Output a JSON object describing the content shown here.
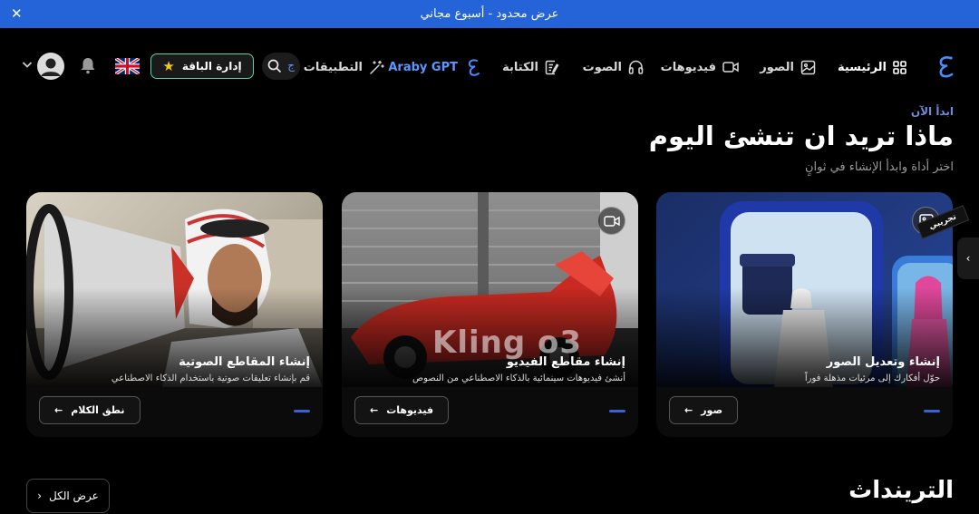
{
  "promo": {
    "text": "عرض محدود - أسبوع مجاني"
  },
  "nav": {
    "home": "الرئيسية",
    "images": "الصور",
    "videos": "فيديوهات",
    "audio": "الصوت",
    "writing": "الكتابة",
    "gpt": "Araby GPT",
    "apps": "التطبيقات",
    "search_fragment": "ج",
    "plan_button": "إدارة الباقة"
  },
  "hero": {
    "eyebrow": "ابدأ الآن",
    "title": "ماذا تريد ان تنشئ اليوم",
    "subtitle": "اختر أداة وابدأ الإنشاء في ثوانٍ"
  },
  "cards": [
    {
      "title": "إنشاء وتعديل الصور",
      "desc": "حوّل أفكارك إلى مرئيات مذهلة فوراً",
      "button": "صور",
      "badge": "تجريبي"
    },
    {
      "title": "إنشاء مقاطع الفيديو",
      "desc": "أنشئ فيديوهات سينمائية بالذكاء الاصطناعي من النصوص",
      "button": "فيديوهات",
      "overlay": "Kling o3"
    },
    {
      "title": "إنشاء المقاطع الصوتية",
      "desc": "قم بإنشاء تعليقات صوتية باستخدام الذكاء الاصطناعي",
      "button": "نطق الكلام"
    }
  ],
  "trends": {
    "title": "الترينداث",
    "view_all": "عرض الكل"
  },
  "colors": {
    "promo": "#2563d8",
    "accent": "#3a62d8",
    "pill_border": "#5dd1b0",
    "logo": "#4a8cff"
  }
}
